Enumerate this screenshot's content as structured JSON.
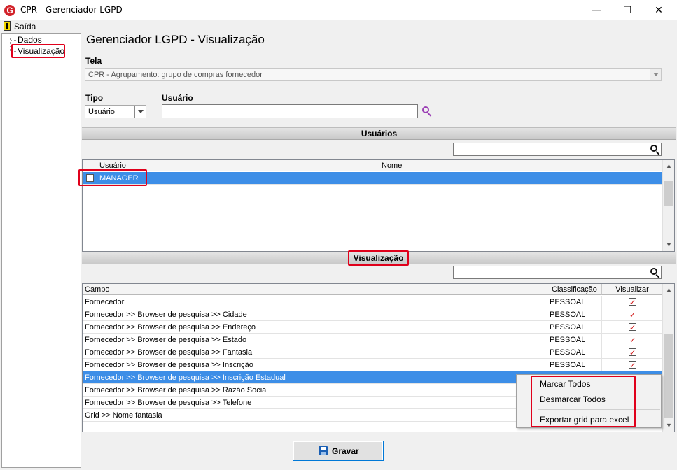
{
  "window": {
    "title": "CPR - Gerenciador LGPD",
    "logo_glyph": "G"
  },
  "menu": {
    "exit_label": "Saída"
  },
  "tree": {
    "items": [
      {
        "label": "Dados"
      },
      {
        "label": "Visualização"
      }
    ]
  },
  "page": {
    "title": "Gerenciador LGPD - Visualização"
  },
  "form": {
    "tela_label": "Tela",
    "tela_value": "CPR - Agrupamento: grupo de compras fornecedor",
    "tipo_label": "Tipo",
    "tipo_value": "Usuário",
    "usuario_label": "Usuário",
    "usuario_value": ""
  },
  "users_section": {
    "title": "Usuários",
    "search_value": "",
    "columns": [
      "Usuário",
      "Nome"
    ],
    "rows": [
      {
        "usuario": "MANAGER",
        "nome": "",
        "checked": false,
        "selected": true
      }
    ]
  },
  "view_section": {
    "title": "Visualização",
    "search_value": "",
    "columns": [
      "Campo",
      "Classificação",
      "Visualizar"
    ],
    "rows": [
      {
        "campo": "Fornecedor",
        "classificacao": "PESSOAL",
        "visualizar": true
      },
      {
        "campo": "Fornecedor >> Browser de pesquisa >> Cidade",
        "classificacao": "PESSOAL",
        "visualizar": true
      },
      {
        "campo": "Fornecedor >> Browser de pesquisa >> Endereço",
        "classificacao": "PESSOAL",
        "visualizar": true
      },
      {
        "campo": "Fornecedor >> Browser de pesquisa >> Estado",
        "classificacao": "PESSOAL",
        "visualizar": true
      },
      {
        "campo": "Fornecedor >> Browser de pesquisa >> Fantasia",
        "classificacao": "PESSOAL",
        "visualizar": true
      },
      {
        "campo": "Fornecedor >> Browser de pesquisa >> Inscrição",
        "classificacao": "PESSOAL",
        "visualizar": true
      },
      {
        "campo": "Fornecedor >> Browser de pesquisa >> Inscrição Estadual",
        "classificacao": "",
        "visualizar": null,
        "selected": true
      },
      {
        "campo": "Fornecedor >> Browser de pesquisa >> Razão Social",
        "classificacao": "",
        "visualizar": null
      },
      {
        "campo": "Fornecedor >> Browser de pesquisa >> Telefone",
        "classificacao": "",
        "visualizar": null
      },
      {
        "campo": "Grid >> Nome fantasia",
        "classificacao": "",
        "visualizar": null
      }
    ]
  },
  "context_menu": {
    "items": [
      {
        "label": "Marcar Todos"
      },
      {
        "label": "Desmarcar Todos"
      },
      {
        "label": "Exportar grid para excel"
      }
    ]
  },
  "footer": {
    "save_label": "Gravar"
  },
  "colors": {
    "selection": "#3d8ee7",
    "highlight_frame": "#e0001b",
    "check": "#cc0000"
  }
}
